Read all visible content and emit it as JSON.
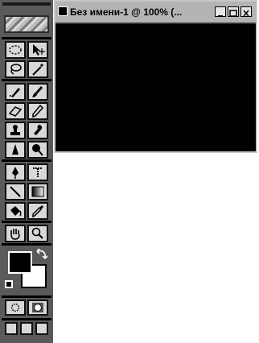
{
  "document": {
    "title": "Без имени-1 @ 100% (..."
  },
  "toolbox": {
    "tools": [
      {
        "id": "marquee",
        "icon": "marquee-icon"
      },
      {
        "id": "move",
        "icon": "move-icon"
      },
      {
        "id": "lasso",
        "icon": "lasso-icon"
      },
      {
        "id": "magic-wand",
        "icon": "magic-wand-icon"
      },
      {
        "id": "airbrush",
        "icon": "airbrush-icon"
      },
      {
        "id": "paintbrush",
        "icon": "paintbrush-icon"
      },
      {
        "id": "eraser",
        "icon": "eraser-icon"
      },
      {
        "id": "pencil",
        "icon": "pencil-icon"
      },
      {
        "id": "rubber-stamp",
        "icon": "stamp-icon"
      },
      {
        "id": "smudge",
        "icon": "smudge-icon"
      },
      {
        "id": "blur",
        "icon": "blur-icon"
      },
      {
        "id": "dodge",
        "icon": "dodge-icon"
      },
      {
        "id": "pen",
        "icon": "pen-icon"
      },
      {
        "id": "type",
        "icon": "type-icon"
      },
      {
        "id": "line",
        "icon": "line-icon"
      },
      {
        "id": "gradient",
        "icon": "gradient-icon"
      },
      {
        "id": "paint-bucket",
        "icon": "paint-bucket-icon"
      },
      {
        "id": "eyedropper",
        "icon": "eyedropper-icon"
      },
      {
        "id": "hand",
        "icon": "hand-icon"
      },
      {
        "id": "zoom",
        "icon": "zoom-icon"
      }
    ],
    "colors": {
      "foreground": "#000000",
      "background": "#ffffff"
    }
  }
}
